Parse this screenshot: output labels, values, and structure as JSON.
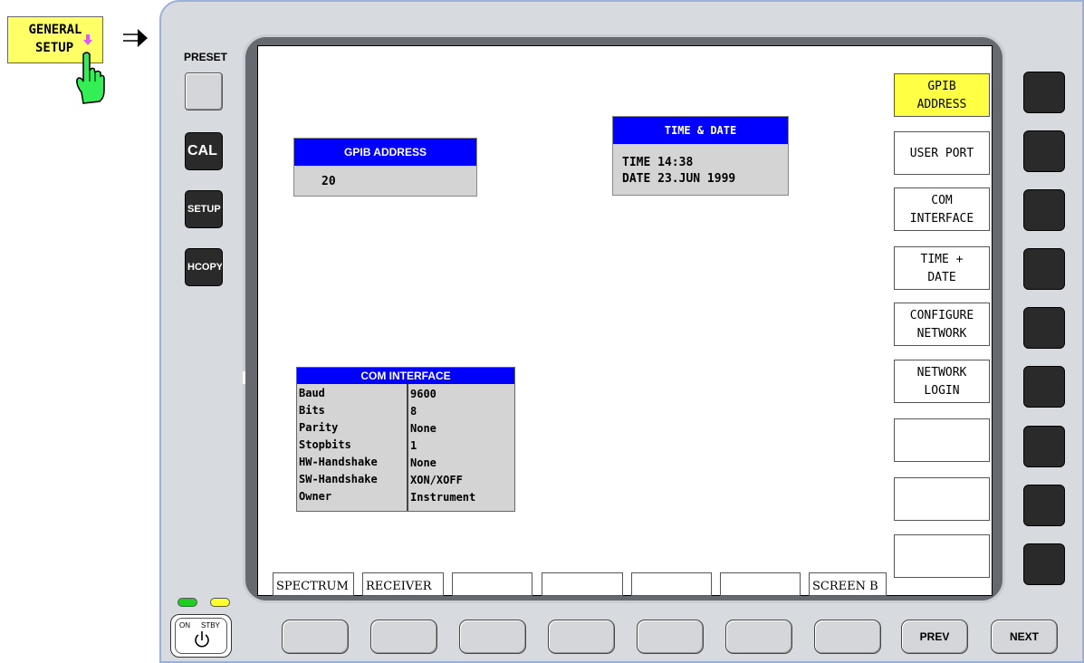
{
  "menu_key": {
    "line1": "GENERAL",
    "line2": "SETUP"
  },
  "left_keys": {
    "preset_label": "PRESET",
    "cal": "CAL",
    "setup": "SETUP",
    "hcopy": "HCOPY"
  },
  "gpib": {
    "title": "GPIB ADDRESS",
    "value": "20"
  },
  "time_date": {
    "title": "TIME & DATE",
    "time": "TIME 14:38",
    "date": "DATE 23.JUN 1999"
  },
  "com_interface": {
    "title": "COM INTERFACE",
    "rows": [
      {
        "key": "Baud",
        "value": "9600"
      },
      {
        "key": "Bits",
        "value": "8"
      },
      {
        "key": "Parity",
        "value": "None"
      },
      {
        "key": "Stopbits",
        "value": "1"
      },
      {
        "key": "HW-Handshake",
        "value": "None"
      },
      {
        "key": "SW-Handshake",
        "value": "XON/XOFF"
      },
      {
        "key": "Owner",
        "value": "Instrument"
      }
    ]
  },
  "softkeys": [
    {
      "line1": "GPIB",
      "line2": "ADDRESS",
      "active": true
    },
    {
      "line1": "USER PORT",
      "line2": ""
    },
    {
      "line1": "COM",
      "line2": "INTERFACE"
    },
    {
      "line1": "TIME +",
      "line2": "DATE"
    },
    {
      "line1": "CONFIGURE",
      "line2": "NETWORK"
    },
    {
      "line1": "NETWORK",
      "line2": "LOGIN"
    },
    {
      "line1": "",
      "line2": ""
    },
    {
      "line1": "",
      "line2": ""
    },
    {
      "line1": "",
      "line2": ""
    }
  ],
  "tabs": [
    "SPECTRUM",
    "RECEIVER",
    "",
    "",
    "",
    "",
    "SCREEN B"
  ],
  "bottom_keys": {
    "prev": "PREV",
    "next": "NEXT"
  },
  "power": {
    "on": "ON",
    "stby": "STBY"
  },
  "colors": {
    "title_blue": "#0000ff",
    "highlight_yellow": "#ffff44",
    "panel_gray": "#d4d4d4"
  }
}
